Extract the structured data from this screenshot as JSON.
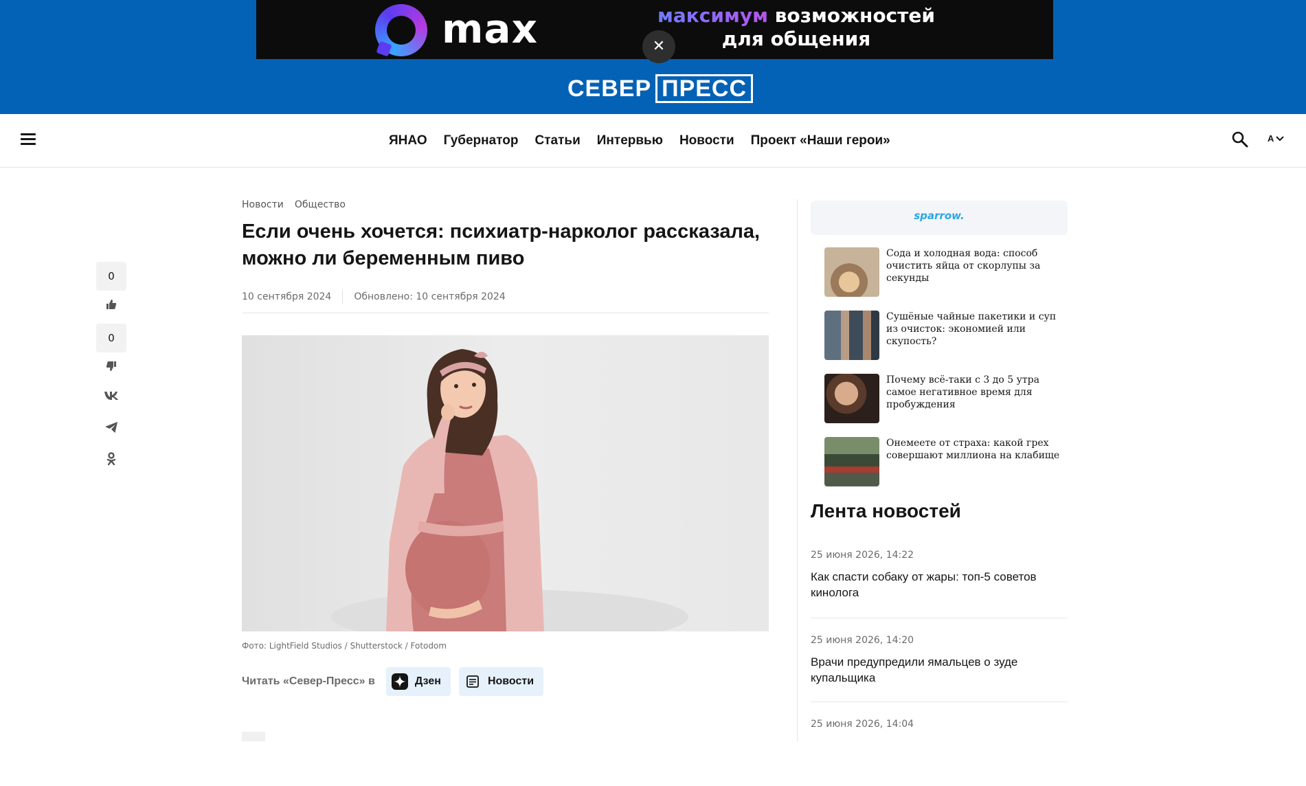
{
  "ad": {
    "brand": "max",
    "line1_accent": "максимум",
    "line1_rest": " возможностей",
    "line2": "для общения",
    "close_glyph": "✕"
  },
  "logo": {
    "left": "СЕВЕР",
    "right": "ПРЕСС"
  },
  "nav": {
    "items": [
      "ЯНАО",
      "Губернатор",
      "Статьи",
      "Интервью",
      "Новости",
      "Проект «Наши герои»"
    ],
    "font_toggle": "A",
    "icons": [
      "menu-icon",
      "search-icon",
      "chevron-down-icon"
    ]
  },
  "share": {
    "likes": "0",
    "dislikes": "0",
    "icons": [
      "thumbs-up-icon",
      "thumbs-down-icon",
      "vk-icon",
      "telegram-icon",
      "odnoklassniki-icon"
    ]
  },
  "article": {
    "breadcrumbs": [
      "Новости",
      "Общество"
    ],
    "title": "Если очень хочется: психиатр-нарколог рассказала, можно ли беременным пиво",
    "published": "10 сентября 2024",
    "updated": "Обновлено: 10 сентября 2024",
    "photo_caption": "Фото: LightField Studios / Shutterstock / Fotodom",
    "read_in_label": "Читать «Север-Пресс» в",
    "read_in_buttons": [
      "Дзен",
      "Новости"
    ]
  },
  "sidebar": {
    "sparrow": "sparrow.",
    "promo": [
      "Сода и холодная вода: способ очистить яйца от скорлупы за секунды",
      "Сушёные чайные пакетики и суп из очисток: экономией или скупость?",
      "Почему всё-таки с 3 до 5 утра самое негативное время для пробуждения",
      "Онемеете от страха: какой грех совершают миллиона на клабище"
    ],
    "feed_title": "Лента новостей",
    "feed": [
      {
        "time": "25 июня 2026, 14:22",
        "headline": "Как спасти собаку от жары: топ-5 советов кинолога"
      },
      {
        "time": "25 июня 2026, 14:20",
        "headline": "Врачи предупредили ямальцев о зуде купальщика"
      },
      {
        "time": "25 июня 2026, 14:04",
        "headline": ""
      }
    ]
  },
  "colors": {
    "header_blue": "#0462b6",
    "ad_bg": "#0c0c0c",
    "chip_bg": "#e6f1fb",
    "sparrow_blue": "#2aa6e8"
  }
}
